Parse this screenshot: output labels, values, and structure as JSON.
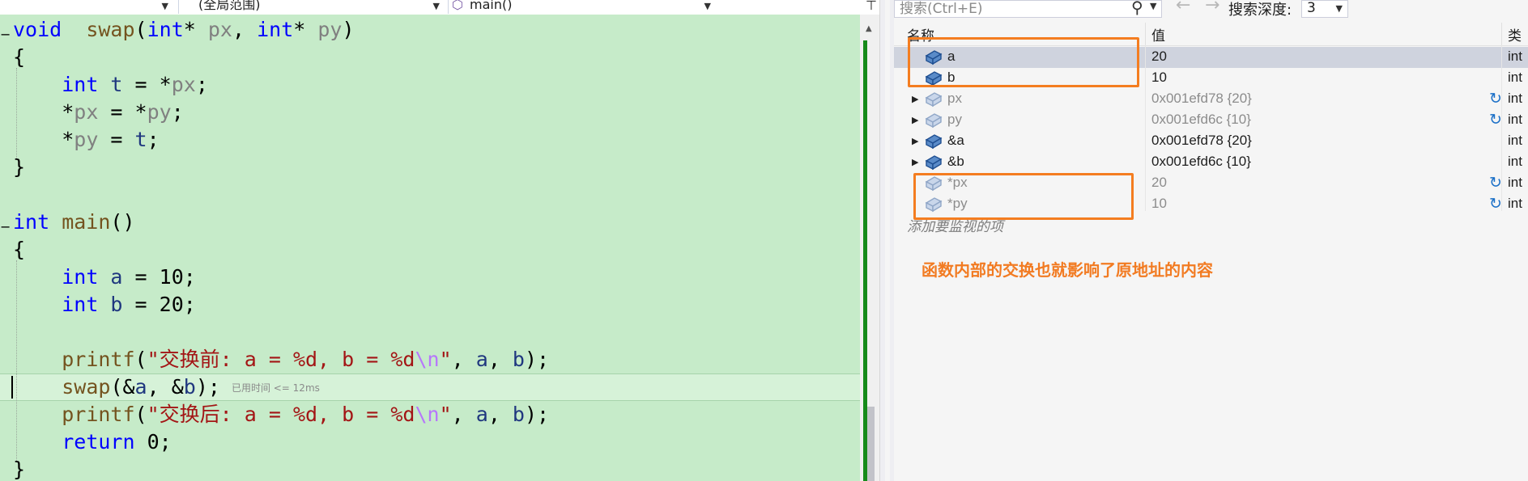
{
  "editor": {
    "nav": {
      "scope_combo": "(全局范围)",
      "function_combo": "main()"
    },
    "lines": [
      {
        "t": [
          [
            "kw",
            "void"
          ],
          [
            "",
            "  "
          ],
          [
            "fn",
            "swap"
          ],
          [
            "",
            "("
          ],
          [
            "kw",
            "int"
          ],
          [
            "",
            "* "
          ],
          [
            "prm",
            "px"
          ],
          [
            "",
            ", "
          ],
          [
            "kw",
            "int"
          ],
          [
            "",
            "* "
          ],
          [
            "prm",
            "py"
          ],
          [
            "",
            ")"
          ]
        ]
      },
      {
        "t": [
          [
            "",
            "{"
          ]
        ]
      },
      {
        "t": [
          [
            "",
            "    "
          ],
          [
            "kw",
            "int"
          ],
          [
            "",
            ""
          ],
          [
            "loc",
            " t"
          ],
          [
            "",
            " = *"
          ],
          [
            "prm",
            "px"
          ],
          [
            "",
            ";"
          ]
        ]
      },
      {
        "t": [
          [
            "",
            "    *"
          ],
          [
            "prm",
            "px"
          ],
          [
            "",
            " = *"
          ],
          [
            "prm",
            "py"
          ],
          [
            "",
            ";"
          ]
        ]
      },
      {
        "t": [
          [
            "",
            "    *"
          ],
          [
            "prm",
            "py"
          ],
          [
            "",
            " = "
          ],
          [
            "loc",
            "t"
          ],
          [
            "",
            ";"
          ]
        ]
      },
      {
        "t": [
          [
            "",
            "}"
          ]
        ]
      },
      {
        "t": []
      },
      {
        "t": [
          [
            "kw",
            "int"
          ],
          [
            "",
            ""
          ],
          [
            "fn",
            " main"
          ],
          [
            "",
            "()"
          ]
        ]
      },
      {
        "t": [
          [
            "",
            "{"
          ]
        ]
      },
      {
        "t": [
          [
            "",
            "    "
          ],
          [
            "kw",
            "int"
          ],
          [
            "",
            ""
          ],
          [
            "loc",
            " a"
          ],
          [
            "",
            " = 10;"
          ]
        ]
      },
      {
        "t": [
          [
            "",
            "    "
          ],
          [
            "kw",
            "int"
          ],
          [
            "",
            ""
          ],
          [
            "loc",
            " b"
          ],
          [
            "",
            " = 20;"
          ]
        ]
      },
      {
        "t": []
      },
      {
        "t": [
          [
            "",
            "    "
          ],
          [
            "fn",
            "printf"
          ],
          [
            "",
            "("
          ],
          [
            "str",
            "\"交换前: a = %d, b = %d"
          ],
          [
            "esc",
            "\\n"
          ],
          [
            "str",
            "\""
          ],
          [
            "",
            ", "
          ],
          [
            "loc",
            "a"
          ],
          [
            "",
            ", "
          ],
          [
            "loc",
            "b"
          ],
          [
            "",
            ");"
          ]
        ]
      },
      {
        "t": [
          [
            "",
            "    "
          ],
          [
            "fn",
            "swap"
          ],
          [
            "",
            "(&"
          ],
          [
            "loc",
            "a"
          ],
          [
            "",
            ", &"
          ],
          [
            "loc",
            "b"
          ],
          [
            "",
            ");"
          ]
        ],
        "hint": "已用时间 <= 12ms"
      },
      {
        "t": [
          [
            "",
            "    "
          ],
          [
            "fn",
            "printf"
          ],
          [
            "",
            "("
          ],
          [
            "str",
            "\"交换后: a = %d, b = %d"
          ],
          [
            "esc",
            "\\n"
          ],
          [
            "str",
            "\""
          ],
          [
            "",
            ", "
          ],
          [
            "loc",
            "a"
          ],
          [
            "",
            ", "
          ],
          [
            "loc",
            "b"
          ],
          [
            "",
            ");"
          ]
        ]
      },
      {
        "t": [
          [
            "",
            "    "
          ],
          [
            "kw",
            "return"
          ],
          [
            "",
            " 0;"
          ]
        ]
      },
      {
        "t": [
          [
            "",
            "}"
          ]
        ]
      }
    ]
  },
  "watch": {
    "search_placeholder": "搜索(Ctrl+E)",
    "search_depth_label": "搜索深度:",
    "search_depth_value": "3",
    "columns": {
      "name": "名称",
      "value": "值",
      "type": "类"
    },
    "rows": [
      {
        "name": "a",
        "value": "20",
        "type": "int",
        "style": "dark",
        "expandable": false,
        "refresh": false,
        "selected": true
      },
      {
        "name": "b",
        "value": "10",
        "type": "int",
        "style": "dark",
        "expandable": false,
        "refresh": false,
        "selected": false
      },
      {
        "name": "px",
        "value": "0x001efd78 {20}",
        "type": "int",
        "style": "grey",
        "expandable": true,
        "refresh": true,
        "selected": false
      },
      {
        "name": "py",
        "value": "0x001efd6c {10}",
        "type": "int",
        "style": "grey",
        "expandable": true,
        "refresh": true,
        "selected": false
      },
      {
        "name": "&a",
        "value": "0x001efd78 {20}",
        "type": "int",
        "style": "dark",
        "expandable": true,
        "refresh": false,
        "selected": false
      },
      {
        "name": "&b",
        "value": "0x001efd6c {10}",
        "type": "int",
        "style": "dark",
        "expandable": true,
        "refresh": false,
        "selected": false
      },
      {
        "name": "*px",
        "value": "20",
        "type": "int",
        "style": "grey",
        "expandable": false,
        "refresh": true,
        "selected": false
      },
      {
        "name": "*py",
        "value": "10",
        "type": "int",
        "style": "grey",
        "expandable": false,
        "refresh": true,
        "selected": false
      }
    ],
    "add_watch_hint": "添加要监视的项"
  },
  "annotation": "函数内部的交换也就影响了原地址的内容",
  "colors": {
    "editor_bg": "#c6ebc9",
    "keyword": "#0000ff",
    "function": "#74531f",
    "parameter": "#808080",
    "local": "#1f377f",
    "string": "#a31515",
    "escape": "#b776fb",
    "change_margin": "#168a1a",
    "annotation": "#f27b22",
    "highlight_box": "#f47d20",
    "refresh_icon": "#1a6fc7"
  },
  "icons": {
    "variable": "blue-cube-icon",
    "refresh": "refresh-icon",
    "search": "search-icon",
    "expander": "triangle-right-icon"
  }
}
